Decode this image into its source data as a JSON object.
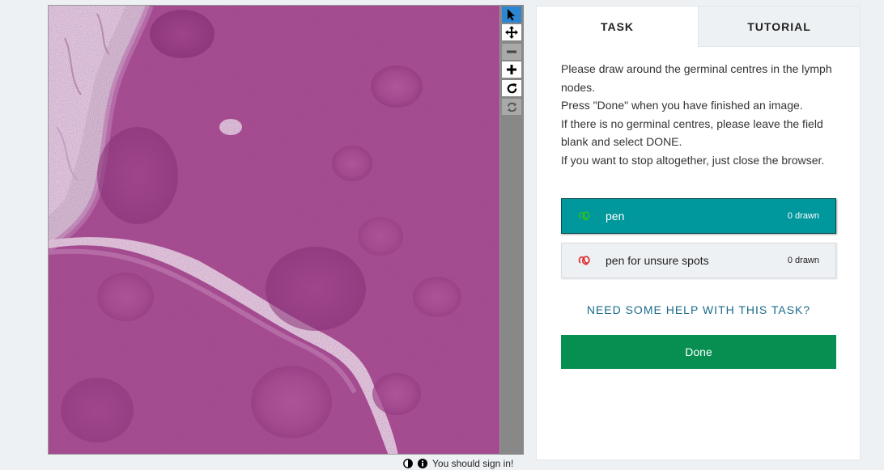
{
  "viewer": {
    "toolbar": {
      "tools": [
        {
          "name": "pointer-tool",
          "icon": "arrow-cursor-icon",
          "state": "active"
        },
        {
          "name": "pan-tool",
          "icon": "move-arrows-icon",
          "state": "normal"
        },
        {
          "name": "zoom-out-tool",
          "icon": "minus-icon",
          "state": "disabled"
        },
        {
          "name": "zoom-in-tool",
          "icon": "plus-icon",
          "state": "normal"
        },
        {
          "name": "rotate-tool",
          "icon": "rotate-icon",
          "state": "normal"
        },
        {
          "name": "reset-tool",
          "icon": "refresh-icon",
          "state": "disabled"
        }
      ]
    }
  },
  "status": {
    "contrast_icon": "contrast-icon",
    "info_icon": "info-icon",
    "sign_in_text": "You should sign in!"
  },
  "panel": {
    "tabs": [
      {
        "label": "TASK",
        "active": true
      },
      {
        "label": "TUTORIAL",
        "active": false
      }
    ],
    "instructions": [
      "Please draw around the germinal centres in the lymph nodes.",
      "Press \"Done\" when you have finished an image.",
      "If there is no germinal centres, please leave the field blank and select DONE.",
      "If you want to stop altogether, just close the browser."
    ],
    "tools": [
      {
        "label": "pen",
        "count": "0 drawn",
        "color": "#2bc02b",
        "selected": true
      },
      {
        "label": "pen for unsure spots",
        "count": "0 drawn",
        "color": "#e02828",
        "selected": false
      }
    ],
    "help_label": "NEED SOME HELP WITH THIS TASK?",
    "done_label": "Done"
  },
  "colors": {
    "accent_teal": "#00979d",
    "done_green": "#078f52",
    "tissue": "#a54a8f"
  }
}
